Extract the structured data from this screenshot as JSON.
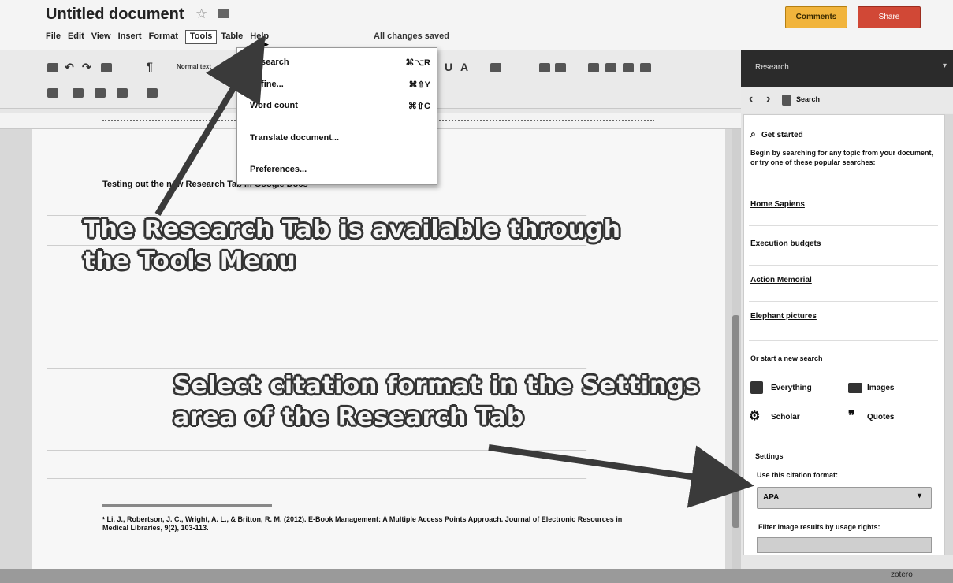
{
  "title": {
    "doc_title": "Untitled document"
  },
  "menu": {
    "items": [
      "File",
      "Edit",
      "View",
      "Insert",
      "Format",
      "Tools",
      "Table",
      "Help"
    ],
    "status": "All changes saved"
  },
  "actions": {
    "comments": "Comments",
    "share": "Share"
  },
  "toolbar": {
    "style": "Normal text"
  },
  "tools_menu": {
    "items": [
      {
        "label": "Research",
        "shortcut": "⌘⌥R"
      },
      {
        "label": "Define...",
        "shortcut": "⌘⇧Y"
      },
      {
        "label": "Word count",
        "shortcut": "⌘⇧C"
      },
      {
        "label": "Translate document..."
      },
      {
        "label": "Preferences..."
      }
    ]
  },
  "document": {
    "line": "Testing out the new Research Tab in Google Docs",
    "footnote": "¹ Li, J., Robertson, J. C., Wright, A. L., & Britton, R. M. (2012). E-Book Management: A Multiple Access Points Approach. Journal of Electronic Resources in Medical Libraries, 9(2), 103-113."
  },
  "research": {
    "header": "Research",
    "search_label": "Search",
    "get_started": "Get started",
    "intro": "Begin by searching for any topic from your document, or try one of these popular searches:",
    "popular": [
      "Home Sapiens",
      "Execution budgets",
      "Action Memorial",
      "Elephant pictures"
    ],
    "new_search": "Or start a new search",
    "types": [
      "Everything",
      "Images",
      "Scholar",
      "Quotes"
    ],
    "settings": "Settings",
    "citation_label": "Use this citation format:",
    "citation_value": "APA",
    "filter_label": "Filter image results by usage rights:"
  },
  "annotations": {
    "callout1": [
      "The Research Tab is available through",
      "the Tools Menu"
    ],
    "callout2": [
      "Select citation format in the Settings",
      "area of the Research Tab"
    ]
  },
  "status": {
    "zoom": "zotero"
  }
}
